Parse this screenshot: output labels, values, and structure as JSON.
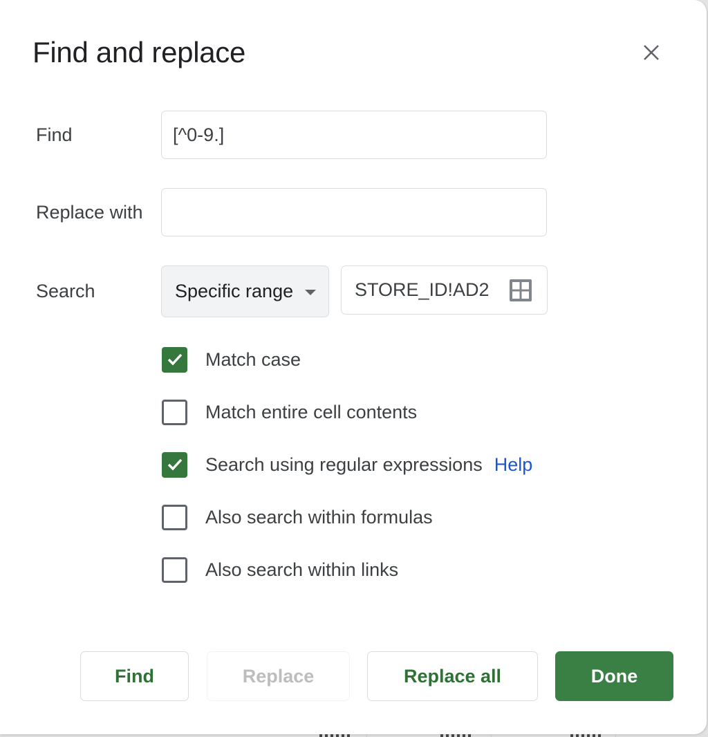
{
  "dialog": {
    "title": "Find and replace",
    "close_icon": "close-icon"
  },
  "find": {
    "label": "Find",
    "value": "[^0-9.]"
  },
  "replace": {
    "label": "Replace with",
    "value": ""
  },
  "search": {
    "label": "Search",
    "scope_selected": "Specific range",
    "range_value": "STORE_ID!AD2",
    "range_icon": "grid-select-icon"
  },
  "options": [
    {
      "label": "Match case",
      "checked": true
    },
    {
      "label": "Match entire cell contents",
      "checked": false
    },
    {
      "label": "Search using regular expressions",
      "checked": true,
      "help_link": "Help"
    },
    {
      "label": "Also search within formulas",
      "checked": false
    },
    {
      "label": "Also search within links",
      "checked": false
    }
  ],
  "buttons": {
    "find": "Find",
    "replace": "Replace",
    "replace_all": "Replace all",
    "done": "Done"
  },
  "colors": {
    "accent_green": "#3a7f43",
    "checkbox_green": "#36773d",
    "link_blue": "#1a56d6",
    "disabled_text": "#bdbdbd"
  }
}
